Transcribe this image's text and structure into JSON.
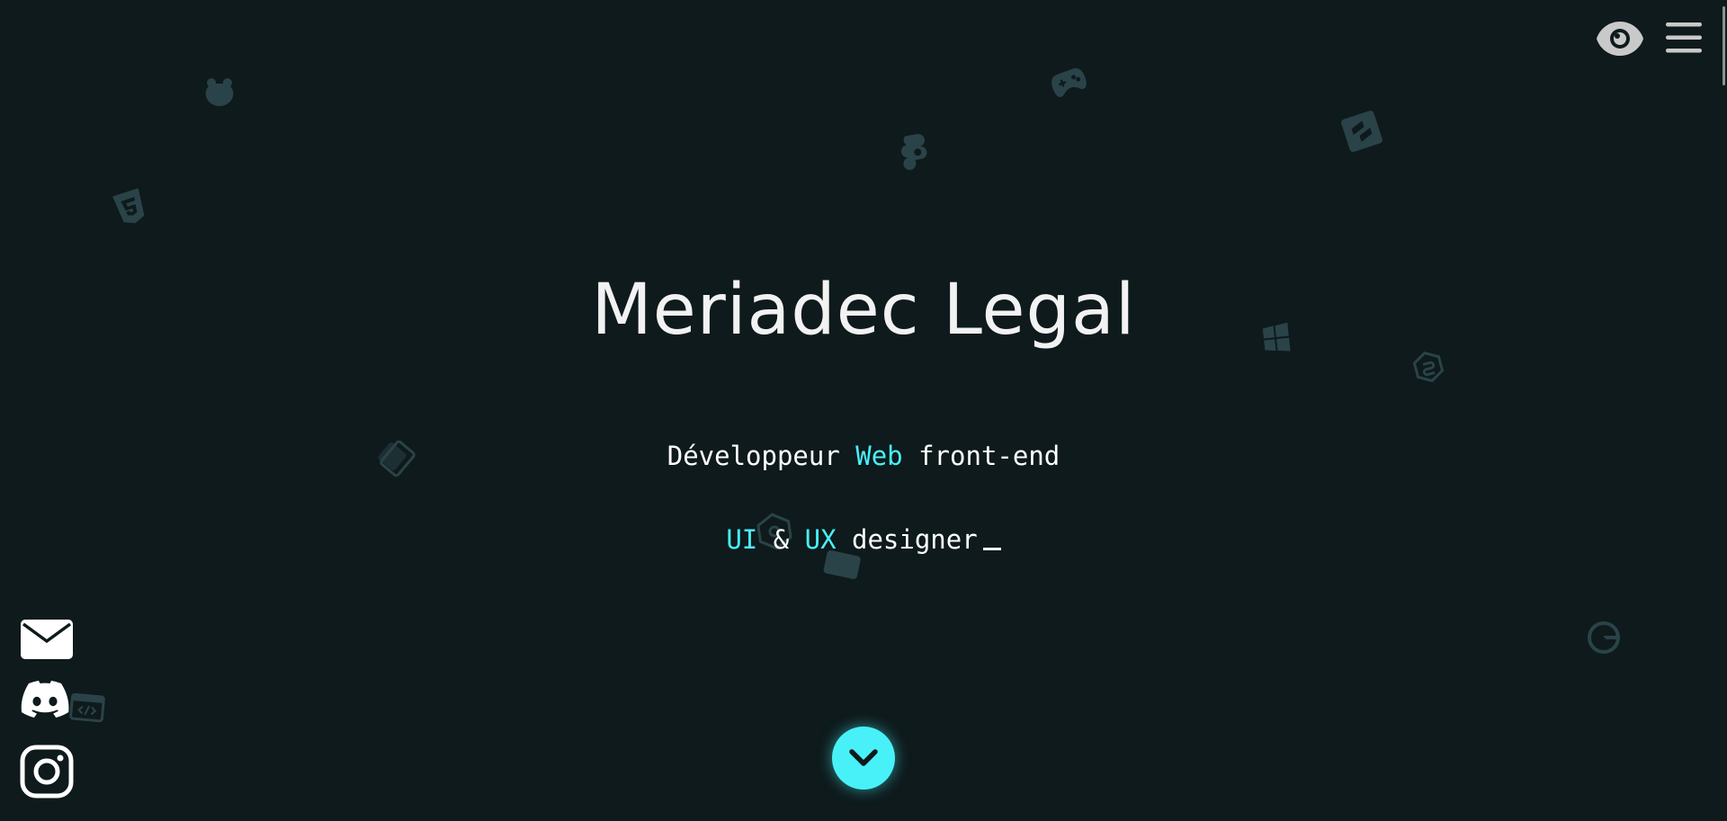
{
  "hero": {
    "name": "Meriadec Legal",
    "line1": {
      "part1": "Développeur ",
      "accent": "Web",
      "part2": " front-end"
    },
    "line2": {
      "accent1": "UI",
      "mid": " & ",
      "accent2": "UX",
      "rest": " designer"
    }
  },
  "colors": {
    "background": "#0e1a1c",
    "accent": "#48f1f8",
    "text": "#ffffff",
    "decoration": "#2f4b50"
  },
  "icons": {
    "top_bar": [
      "eye-icon",
      "menu-icon"
    ],
    "social": [
      "mail-icon",
      "discord-icon",
      "instagram-icon"
    ],
    "scroll": "chevron-down-icon",
    "background_decorations": [
      "frog-icon",
      "gamepad-icon",
      "figma-icon",
      "sublime-text-icon",
      "css3-icon",
      "windows-icon",
      "nuxt-icon",
      "react-icon",
      "webpack-icon",
      "gitkraken-icon",
      "code-window-icon",
      "gatsby-icon"
    ]
  }
}
